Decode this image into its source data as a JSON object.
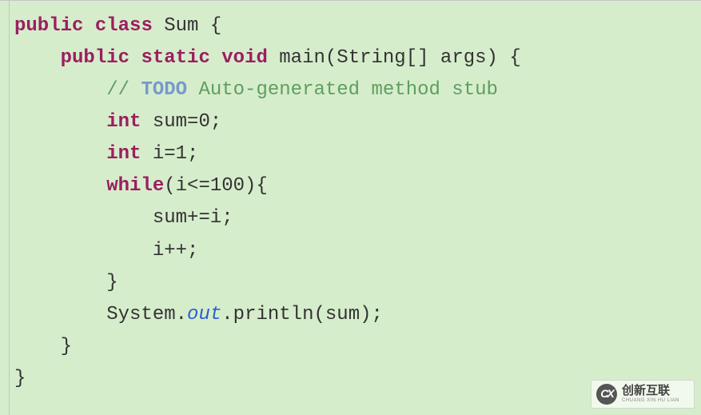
{
  "code": {
    "line1_kw1": "public",
    "line1_kw2": "class",
    "line1_name": " Sum {",
    "line2": "",
    "line3_indent": "    ",
    "line3_kw1": "public",
    "line3_kw2": "static",
    "line3_kw3": "void",
    "line3_rest": " main(String[] args) {",
    "line4_indent": "        ",
    "line4_slash": "// ",
    "line4_todo": "TODO",
    "line4_text": " Auto-generated method stub",
    "line5_indent": "        ",
    "line5_kw": "int",
    "line5_rest": " sum=0;",
    "line6_indent": "        ",
    "line6_kw": "int",
    "line6_rest": " i=1;",
    "line7_indent": "        ",
    "line7_kw": "while",
    "line7_rest": "(i<=100){",
    "line8": "            sum+=i;",
    "line9": "            i++;",
    "line10": "        }",
    "line11_indent": "        System.",
    "line11_field": "out",
    "line11_rest": ".println(sum);",
    "line12": "    }",
    "line13": "",
    "line14": "}"
  },
  "watermark": {
    "logo": "CX",
    "main": "创新互联",
    "sub": "CHUANG XIN HU LIAN"
  }
}
